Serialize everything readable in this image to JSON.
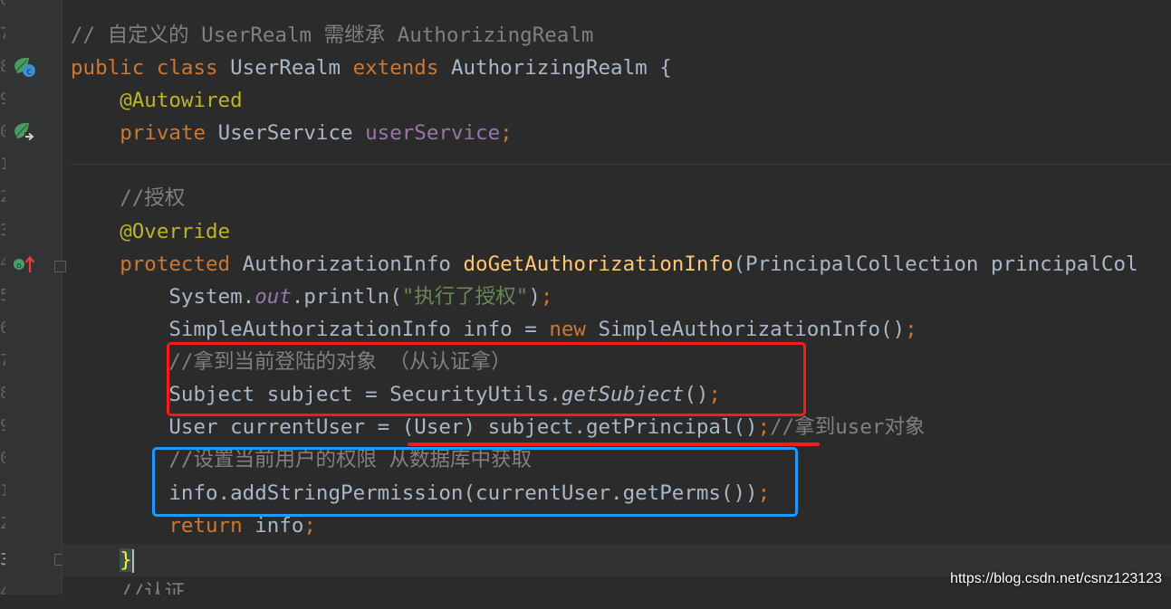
{
  "gutter": {
    "line_numbers": [
      "6",
      "7",
      "8",
      "9",
      "0",
      "1",
      "2",
      "3",
      "4",
      "5",
      "6",
      "7",
      "8",
      "9",
      "0",
      "1",
      "2",
      "3",
      "4"
    ]
  },
  "code": {
    "l1": {
      "comment": "// 自定义的 UserRealm 需继承 AuthorizingRealm"
    },
    "l2": {
      "kw1": "public",
      "kw2": "class",
      "name": "UserRealm",
      "kw3": "extends",
      "parent": "AuthorizingRealm",
      "brace": "{"
    },
    "l3": {
      "annotation": "@Autowired"
    },
    "l4": {
      "kw": "private",
      "type": "UserService",
      "field": "userService",
      "semi": ";"
    },
    "l6": {
      "comment": "//授权"
    },
    "l7": {
      "annotation": "@Override"
    },
    "l8": {
      "kw": "protected",
      "type": "AuthorizationInfo",
      "method": "doGetAuthorizationInfo",
      "params": "(PrincipalCollection principalCol"
    },
    "l9": {
      "cls": "System.",
      "field": "out",
      "rest": ".println(",
      "str": "\"执行了授权\"",
      "end": ")",
      "semi": ";"
    },
    "l10": {
      "decl": "SimpleAuthorizationInfo info = ",
      "kw": "new",
      "rest": " SimpleAuthorizationInfo()",
      "semi": ";"
    },
    "l11": {
      "comment": "//拿到当前登陆的对象 （从认证拿）"
    },
    "l12": {
      "pre": "Subject subject = SecurityUtils.",
      "call": "getSubject",
      "post": "()",
      "semi": ";"
    },
    "l13": {
      "code": "User currentUser = (User) subject.getPrincipal()",
      "semi": ";",
      "comment": "//拿到user对象"
    },
    "l14": {
      "comment": "//设置当前用户的权限 从数据库中获取"
    },
    "l15": {
      "code": "info.addStringPermission(currentUser.getPerms())",
      "semi": ";"
    },
    "l16": {
      "kw": "return",
      "rest": " info",
      "semi": ";"
    },
    "l17": {
      "brace": "}"
    },
    "l18": {
      "comment": "//认证"
    }
  },
  "colors": {
    "box_red": "#ff1a1a",
    "box_blue": "#1a9bff",
    "keyword": "#cc7832",
    "annotation": "#bbb529"
  },
  "watermark": "https://blog.csdn.net/csnz123123"
}
